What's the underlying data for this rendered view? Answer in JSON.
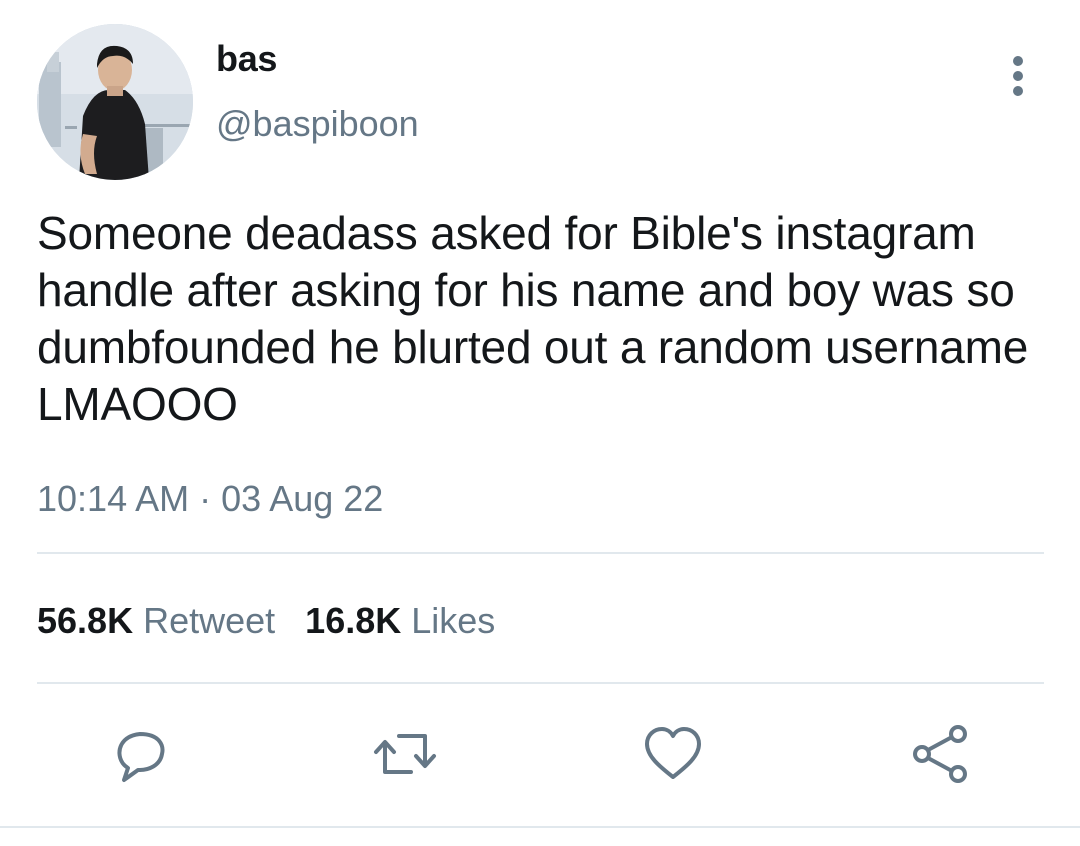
{
  "tweet": {
    "author": {
      "name": "bas",
      "handle": "@baspiboon"
    },
    "text": "Someone deadass asked for Bible's instagram handle after asking for his name and boy was so dumbfounded he blurted out a random username LMAOOO",
    "time": "10:14 AM",
    "separator": "·",
    "date": "03 Aug 22",
    "stats": {
      "retweets_count": "56.8K",
      "retweets_label": "Retweet",
      "likes_count": "16.8K",
      "likes_label": "Likes"
    },
    "actions": [
      "reply-icon",
      "retweet-icon",
      "like-icon",
      "share-icon"
    ]
  },
  "colors": {
    "text": "#14171a",
    "secondary": "#657786",
    "divider": "#e1e8ed"
  }
}
